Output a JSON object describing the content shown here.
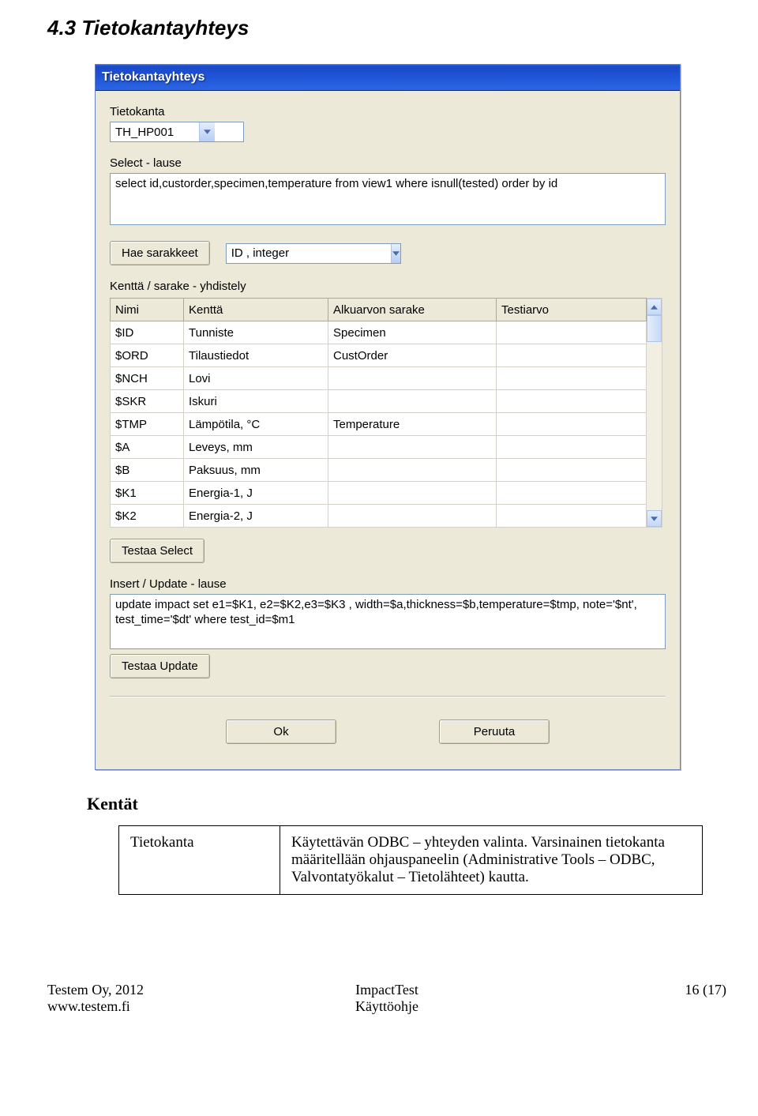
{
  "heading": "4.3 Tietokantayhteys",
  "window": {
    "title": "Tietokantayhteys",
    "db_label": "Tietokanta",
    "db_value": "TH_HP001",
    "select_label": "Select - lause",
    "select_text": "select id,custorder,specimen,temperature from view1 where isnull(tested) order by id",
    "hae_btn": "Hae sarakkeet",
    "col_dd_value": "ID , integer",
    "mapping_label": "Kenttä / sarake - yhdistely",
    "grid_headers": [
      "Nimi",
      "Kenttä",
      "Alkuarvon sarake",
      "Testiarvo"
    ],
    "grid_rows": [
      {
        "nimi": "$ID",
        "kentta": "Tunniste",
        "alku": "Specimen",
        "test": ""
      },
      {
        "nimi": "$ORD",
        "kentta": "Tilaustiedot",
        "alku": "CustOrder",
        "test": ""
      },
      {
        "nimi": "$NCH",
        "kentta": "Lovi",
        "alku": "",
        "test": ""
      },
      {
        "nimi": "$SKR",
        "kentta": "Iskuri",
        "alku": "",
        "test": ""
      },
      {
        "nimi": "$TMP",
        "kentta": "Lämpötila, °C",
        "alku": "Temperature",
        "test": ""
      },
      {
        "nimi": "$A",
        "kentta": "Leveys, mm",
        "alku": "",
        "test": ""
      },
      {
        "nimi": "$B",
        "kentta": "Paksuus, mm",
        "alku": "",
        "test": ""
      },
      {
        "nimi": "$K1",
        "kentta": "Energia-1, J",
        "alku": "",
        "test": ""
      },
      {
        "nimi": "$K2",
        "kentta": "Energia-2, J",
        "alku": "",
        "test": ""
      }
    ],
    "test_select_btn": "Testaa Select",
    "insert_label": "Insert / Update - lause",
    "insert_text": "update impact set e1=$K1, e2=$K2,e3=$K3 , width=$a,thickness=$b,temperature=$tmp, note='$nt', test_time='$dt' where test_id=$m1",
    "test_update_btn": "Testaa Update",
    "ok_btn": "Ok",
    "cancel_btn": "Peruuta"
  },
  "kentat_heading": "Kentät",
  "desc_key": "Tietokanta",
  "desc_val": "Käytettävän ODBC – yhteyden valinta. Varsinainen tietokanta määritellään ohjauspaneelin (Administrative Tools – ODBC, Valvontatyökalut – Tietolähteet) kautta.",
  "footer": {
    "left1": "Testem Oy, 2012",
    "left2": "www.testem.fi",
    "mid1": "ImpactTest",
    "mid2": "Käyttöohje",
    "right": "16 (17)"
  }
}
